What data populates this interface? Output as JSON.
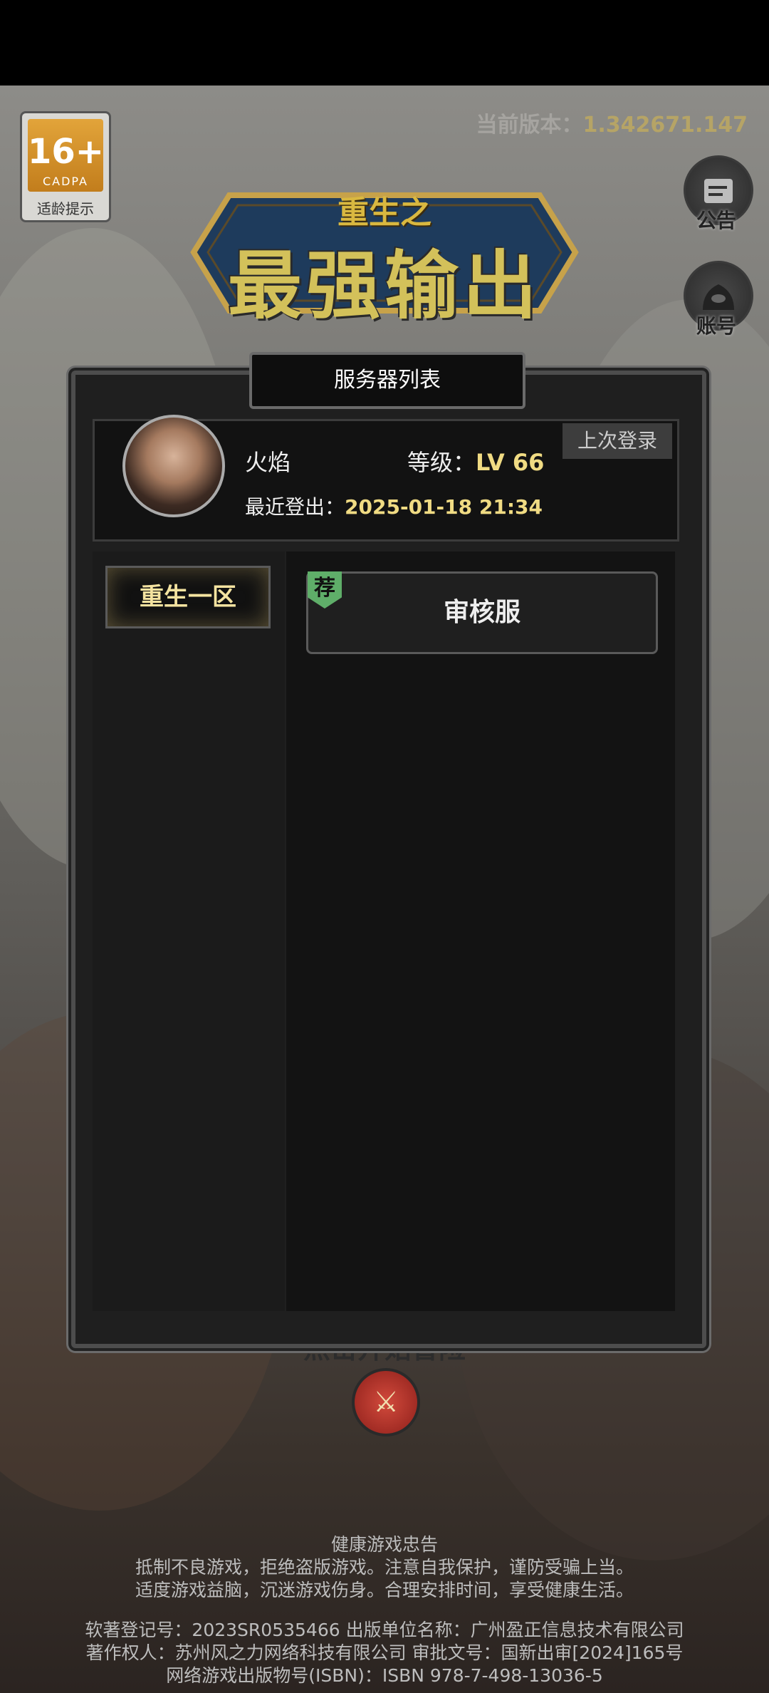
{
  "age_badge": {
    "number": "16+",
    "org": "CADPA",
    "label": "适龄提示"
  },
  "version": {
    "label": "当前版本：",
    "value": "1.342671.147"
  },
  "side_buttons": {
    "notice": "公告",
    "account": "账号"
  },
  "logo": {
    "subtitle": "重生之",
    "title": "最强输出"
  },
  "panel": {
    "title": "服务器列表"
  },
  "user": {
    "name": "火焰",
    "level_label": "等级：",
    "level_value": "LV 66",
    "logout_label": "最近登出：",
    "logout_value": "2025-01-18 21:34",
    "last_login_tag": "上次登录"
  },
  "zones": [
    {
      "label": "重生一区"
    }
  ],
  "servers": [
    {
      "label": "审核服",
      "tag": "荐"
    }
  ],
  "start": {
    "hint": "点击开始冒险",
    "icon": "crossed-swords-icon"
  },
  "footer": {
    "advice_title": "健康游戏忠告",
    "advice_line1": "抵制不良游戏，拒绝盗版游戏。注意自我保护，谨防受骗上当。",
    "advice_line2": "适度游戏益脑，沉迷游戏伤身。合理安排时间，享受健康生活。",
    "info_line1": "软著登记号：2023SR0535466 出版单位名称：广州盈正信息技术有限公司",
    "info_line2": "著作权人：苏州风之力网络科技有限公司 审批文号：国新出审[2024]165号",
    "info_line3": "网络游戏出版物号(ISBN)：ISBN 978-7-498-13036-5"
  },
  "colors": {
    "accent_gold": "#f0db83",
    "tag_green": "#5fae69",
    "panel_bg": "#1f1f1f"
  }
}
